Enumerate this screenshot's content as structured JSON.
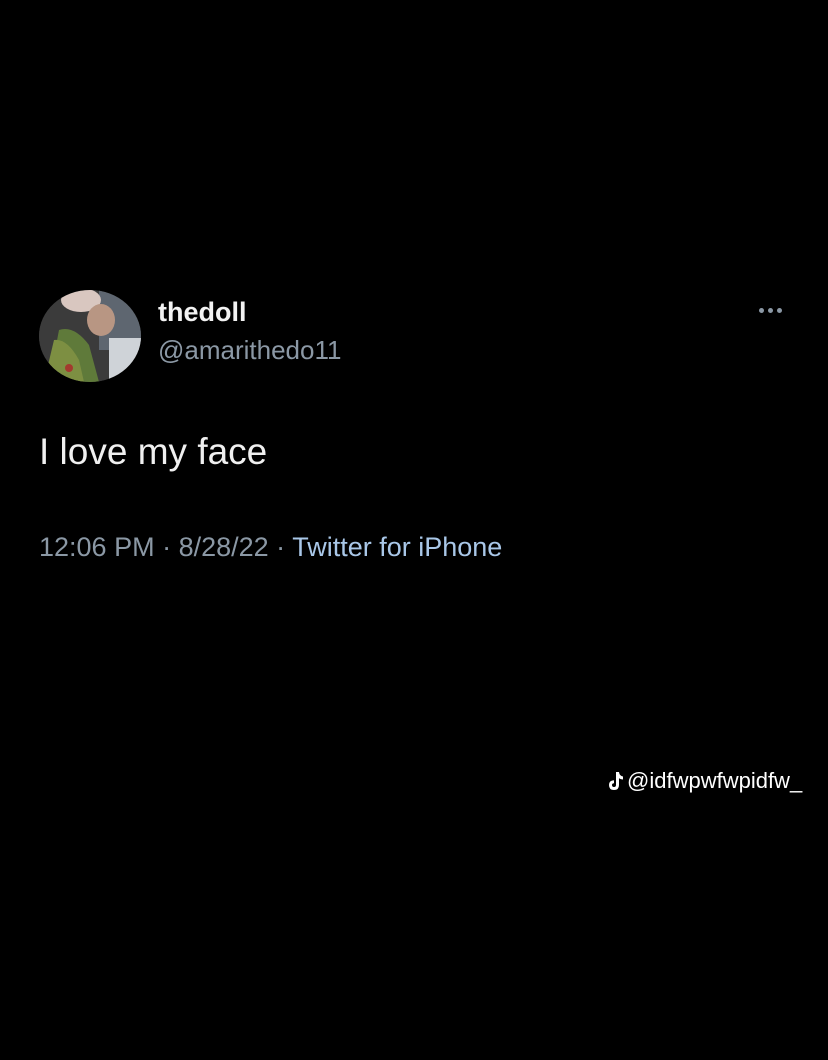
{
  "tweet": {
    "display_name": "thedoll",
    "handle": "@amarithedo11",
    "text": "I love my face",
    "time": "12:06 PM",
    "separator_1": " · ",
    "date": "8/28/22",
    "separator_2": " · ",
    "source": "Twitter for iPhone",
    "more_icon": "ellipsis-icon"
  },
  "watermark": {
    "icon": "tiktok-icon",
    "username": "@idfwpwfwpidfw_"
  },
  "colors": {
    "background": "#000000",
    "primary_text": "#e7e9ea",
    "secondary_text": "#8b98a5",
    "link_text": "#a9c7e8"
  }
}
